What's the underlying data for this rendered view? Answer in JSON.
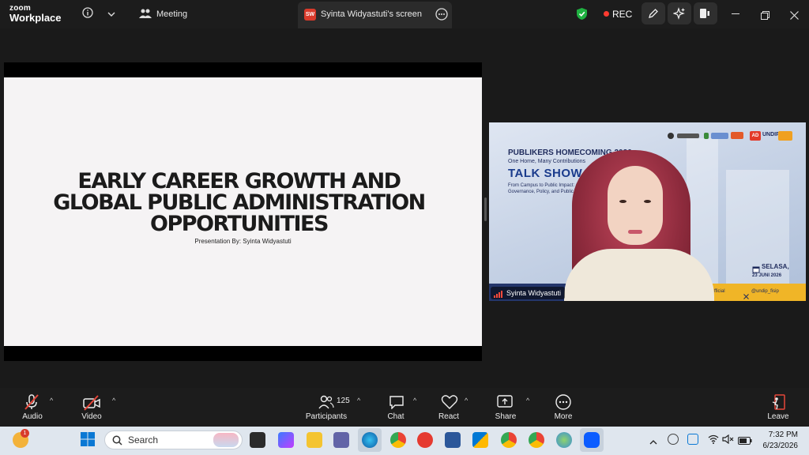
{
  "app": {
    "brand_top": "zoom",
    "brand_bottom": "Workplace"
  },
  "titlebar": {
    "meeting_label": "Meeting",
    "share_badge": "SW",
    "share_tab_label": "Syinta Widyastuti's screen",
    "rec_label": "REC"
  },
  "slide": {
    "title_line1": "EARLY CAREER GROWTH AND",
    "title_line2": "GLOBAL PUBLIC ADMINISTRATION",
    "title_line3": "OPPORTUNITIES",
    "subtitle": "Presentation By: Syinta Widyastuti"
  },
  "video": {
    "banner_line1": "PUBLIKERS HOMECOMING 2026",
    "banner_line2": "One Home, Many Contributions",
    "banner_line3": "TALK SHOW ALU",
    "banner_line4": "From Campus to Public Impact: Alumni Governance, Policy, and Public Leaders",
    "day_label": "SELASA,",
    "date_label": "23 JUNI 2026",
    "participant_name": "Syinta Widyastuti",
    "strip_left": "fficial",
    "strip_right": "@undip_fisip",
    "logo_undip": "UNDIP"
  },
  "toolbar": {
    "audio": "Audio",
    "video": "Video",
    "participants": "Participants",
    "participants_count": "125",
    "chat": "Chat",
    "react": "React",
    "share": "Share",
    "more": "More",
    "leave": "Leave"
  },
  "taskbar": {
    "search_placeholder": "Search",
    "notification_count": "1",
    "time": "7:32 PM",
    "date": "6/23/2026"
  },
  "colors": {
    "rec_dot": "#ff3b30",
    "shield": "#1fb141",
    "leave": "#e5463a"
  }
}
